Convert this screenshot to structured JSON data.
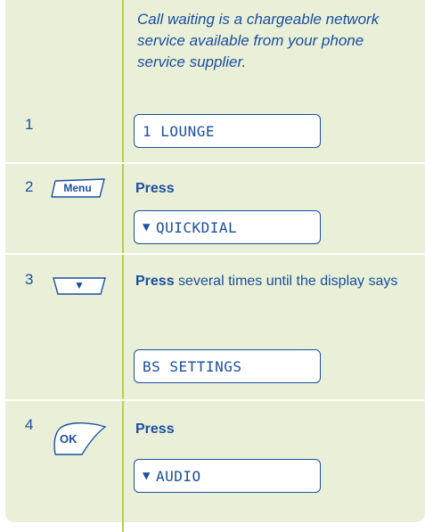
{
  "intro": {
    "text": "Call waiting is a chargeable network service available from your phone service supplier."
  },
  "steps": [
    {
      "number": "1",
      "display": "1 LOUNGE"
    },
    {
      "number": "2",
      "key": "Menu",
      "action": "Press",
      "display": "QUICKDIAL"
    },
    {
      "number": "3",
      "key": "▼",
      "action": "Press",
      "rest": " several times until the display says",
      "display": "BS SETTINGS"
    },
    {
      "number": "4",
      "key": "OK",
      "action": "Press",
      "display": "AUDIO"
    }
  ],
  "colors": {
    "panel": "#eaf0d8",
    "divider": "#b8d04a",
    "text": "#1a4fa0"
  }
}
